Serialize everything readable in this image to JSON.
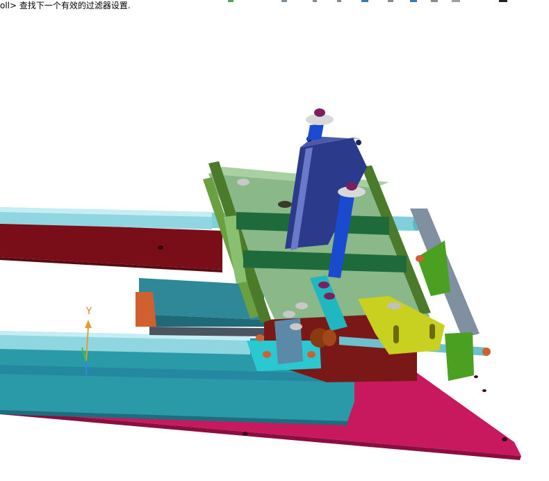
{
  "status_bar": {
    "text": "oll> 查找下一个有效的过滤器设置."
  },
  "axis": {
    "y_label": "Y"
  },
  "toolbar": {
    "icons": [
      "tool-icon-1",
      "tool-icon-2",
      "tool-icon-3",
      "tool-icon-4",
      "tool-icon-5",
      "tool-icon-6",
      "tool-icon-7",
      "tool-icon-8",
      "tool-icon-9",
      "tool-icon-10"
    ]
  }
}
